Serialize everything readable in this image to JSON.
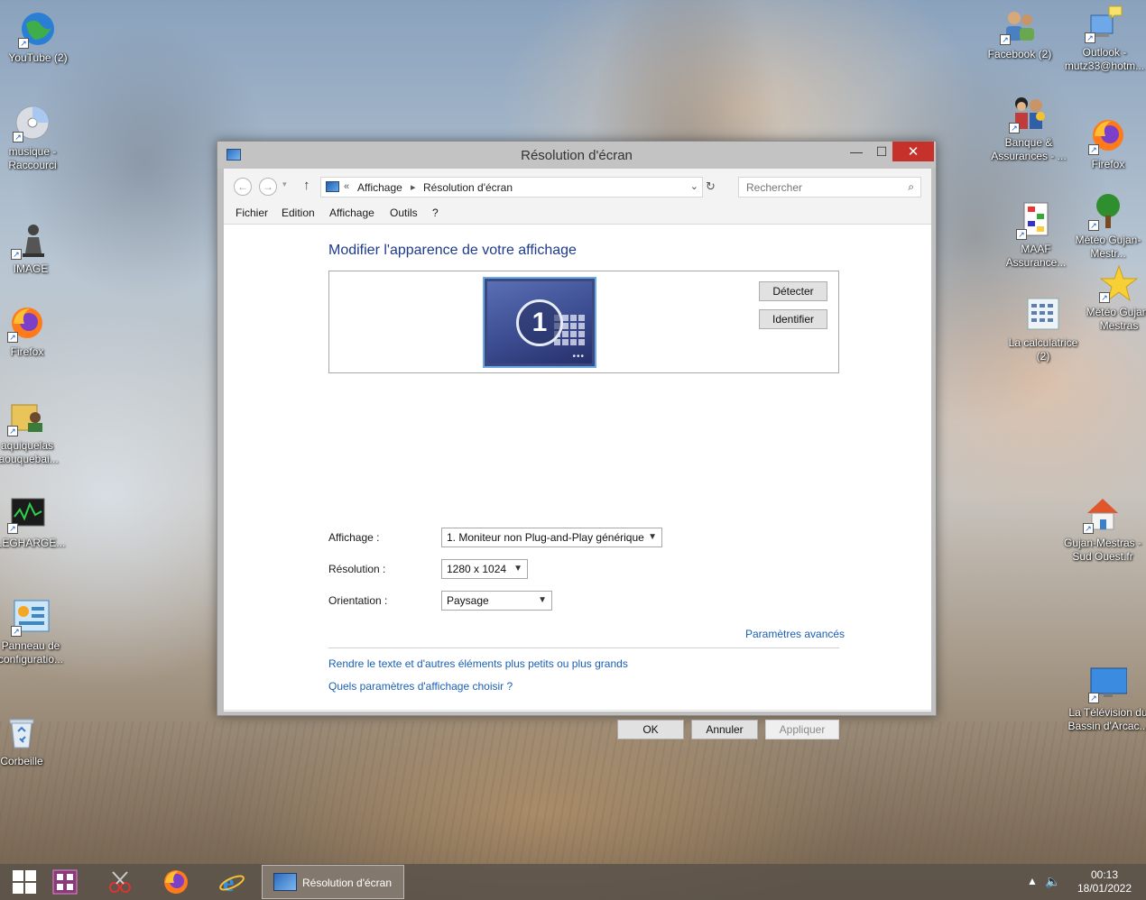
{
  "desktop": {
    "icons_left": [
      {
        "label": "YouTube (2)"
      },
      {
        "label": "musique - Raccourci"
      },
      {
        "label": "IMAGE"
      },
      {
        "label": "Firefox"
      },
      {
        "label": "aquiquelas taouquebai..."
      },
      {
        "label": "ELEGHARGE..."
      },
      {
        "label": "Panneau de configuratio..."
      },
      {
        "label": "Corbeille"
      }
    ],
    "icons_right": [
      {
        "label": "Facebook (2)"
      },
      {
        "label": "Outlook - mutz33@hotm..."
      },
      {
        "label": "Banque & Assurances - ..."
      },
      {
        "label": "Firefox"
      },
      {
        "label": "MAAF Assurance..."
      },
      {
        "label": "Météo Gujan-Mestr..."
      },
      {
        "label": "Météo Gujan-Mestras"
      },
      {
        "label": "La calculatrice (2)"
      },
      {
        "label": "Gujan-Mestras - Sud Ouest.fr"
      },
      {
        "label": "La Télévision du Bassin d'Arcac..."
      }
    ]
  },
  "window": {
    "title": "Résolution d'écran",
    "close_glyph": "✕",
    "min_glyph": "—",
    "max_glyph": "☐",
    "address": {
      "prefix": "«",
      "crumbs": [
        "Affichage",
        "Résolution d'écran"
      ],
      "separator": "▸"
    },
    "search": {
      "placeholder": "Rechercher"
    },
    "menu": [
      "Fichier",
      "Edition",
      "Affichage",
      "Outils",
      "?"
    ],
    "heading": "Modifier l'apparence de votre affichage",
    "monitor": {
      "number": "1"
    },
    "buttons": {
      "detect": "Détecter",
      "identify": "Identifier",
      "ok": "OK",
      "cancel": "Annuler",
      "apply": "Appliquer"
    },
    "fields": {
      "display": {
        "label": "Affichage :",
        "value": "1. Moniteur non Plug-and-Play générique"
      },
      "resolution": {
        "label": "Résolution :",
        "value": "1280 x 1024"
      },
      "orientation": {
        "label": "Orientation :",
        "value": "Paysage"
      }
    },
    "links": {
      "advanced": "Paramètres avancés",
      "text_size": "Rendre le texte et d'autres éléments plus petits ou plus grands",
      "which_settings": "Quels paramètres d'affichage choisir ?"
    }
  },
  "taskbar": {
    "active_task": "Résolution d'écran",
    "time": "00:13",
    "date": "18/01/2022"
  },
  "colors": {
    "accent_link": "#1a5fb4",
    "heading": "#1e3a8a",
    "close_red": "#c7312c"
  }
}
